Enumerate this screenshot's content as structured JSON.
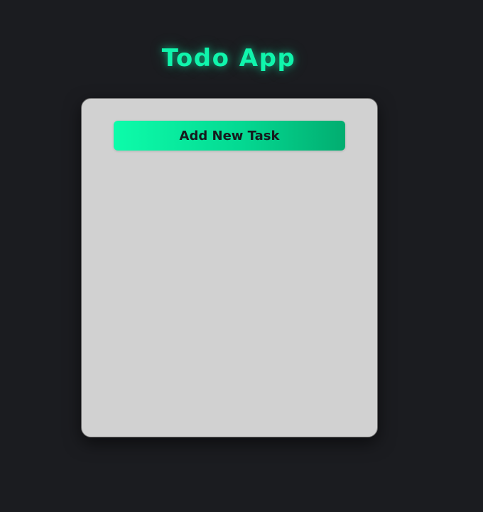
{
  "app": {
    "title": "Todo App",
    "accent_color": "#10f5ac",
    "background_color": "#1b1c20",
    "card_color": "#d1d1d1"
  },
  "todo": {
    "add_button_label": "Add New Task",
    "tasks": []
  }
}
